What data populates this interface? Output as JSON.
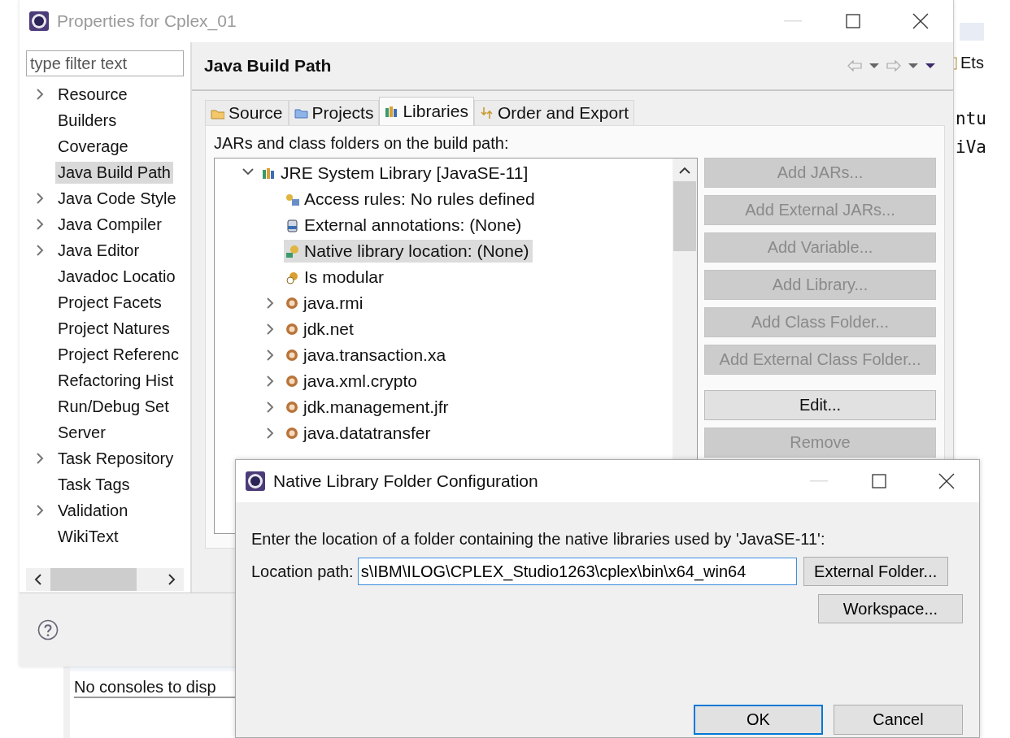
{
  "window": {
    "title": "Properties for Cplex_01"
  },
  "filter": {
    "placeholder": "type filter text"
  },
  "sidebar": {
    "items": [
      {
        "label": "Resource",
        "expandable": true,
        "selected": false
      },
      {
        "label": "Builders",
        "expandable": false,
        "selected": false
      },
      {
        "label": "Coverage",
        "expandable": false,
        "selected": false
      },
      {
        "label": "Java Build Path",
        "expandable": false,
        "selected": true
      },
      {
        "label": "Java Code Style",
        "expandable": true,
        "selected": false
      },
      {
        "label": "Java Compiler",
        "expandable": true,
        "selected": false
      },
      {
        "label": "Java Editor",
        "expandable": true,
        "selected": false
      },
      {
        "label": "Javadoc Locatio",
        "expandable": false,
        "selected": false
      },
      {
        "label": "Project Facets",
        "expandable": false,
        "selected": false
      },
      {
        "label": "Project Natures",
        "expandable": false,
        "selected": false
      },
      {
        "label": "Project Referenc",
        "expandable": false,
        "selected": false
      },
      {
        "label": "Refactoring Hist",
        "expandable": false,
        "selected": false
      },
      {
        "label": "Run/Debug Set",
        "expandable": false,
        "selected": false
      },
      {
        "label": "Server",
        "expandable": false,
        "selected": false
      },
      {
        "label": "Task Repository",
        "expandable": true,
        "selected": false
      },
      {
        "label": "Task Tags",
        "expandable": false,
        "selected": false
      },
      {
        "label": "Validation",
        "expandable": true,
        "selected": false
      },
      {
        "label": "WikiText",
        "expandable": false,
        "selected": false
      }
    ]
  },
  "page": {
    "title": "Java Build Path"
  },
  "tabs": [
    {
      "label": "Source",
      "selected": false
    },
    {
      "label": "Projects",
      "selected": false
    },
    {
      "label": "Libraries",
      "selected": true
    },
    {
      "label": "Order and Export",
      "selected": false
    }
  ],
  "libraries": {
    "label": "JARs and class folders on the build path:",
    "tree": [
      {
        "label": "JRE System Library [JavaSE-11]",
        "expanded": true,
        "children": [
          {
            "label": "Access rules: No rules defined",
            "kind": "attribute",
            "selected": false
          },
          {
            "label": "External annotations: (None)",
            "kind": "attribute",
            "selected": false
          },
          {
            "label": "Native library location: (None)",
            "kind": "attribute",
            "selected": true
          },
          {
            "label": "Is modular",
            "kind": "attribute",
            "selected": false
          },
          {
            "label": "java.rmi",
            "kind": "module",
            "expanded": false,
            "selected": false
          },
          {
            "label": "jdk.net",
            "kind": "module",
            "expanded": false,
            "selected": false
          },
          {
            "label": "java.transaction.xa",
            "kind": "module",
            "expanded": false,
            "selected": false
          },
          {
            "label": "java.xml.crypto",
            "kind": "module",
            "expanded": false,
            "selected": false
          },
          {
            "label": "jdk.management.jfr",
            "kind": "module",
            "expanded": false,
            "selected": false
          },
          {
            "label": "java.datatransfer",
            "kind": "module",
            "expanded": false,
            "selected": false
          }
        ]
      }
    ],
    "buttons": [
      {
        "label": "Add JARs...",
        "disabled": true
      },
      {
        "label": "Add External JARs...",
        "disabled": true
      },
      {
        "label": "Add Variable...",
        "disabled": true
      },
      {
        "label": "Add Library...",
        "disabled": true
      },
      {
        "label": "Add Class Folder...",
        "disabled": true
      },
      {
        "label": "Add External Class Folder...",
        "disabled": true
      },
      {
        "label": "Edit...",
        "disabled": false
      },
      {
        "label": "Remove",
        "disabled": true
      }
    ]
  },
  "dialog": {
    "title": "Native Library Folder Configuration",
    "message": "Enter the location of a folder containing the native libraries used by 'JavaSE-11':",
    "location_label": "Location path:",
    "location_value": "s\\IBM\\ILOG\\CPLEX_Studio1263\\cplex\\bin\\x64_win64",
    "side_buttons": [
      {
        "label": "External Folder..."
      },
      {
        "label": "Workspace..."
      }
    ],
    "footer_buttons": [
      {
        "label": "OK",
        "default": true
      },
      {
        "label": "Cancel",
        "default": false
      }
    ]
  },
  "background": {
    "editor_texts": [
      "Ets",
      "ntu",
      "iVa"
    ],
    "console_message": "No consoles to disp"
  }
}
